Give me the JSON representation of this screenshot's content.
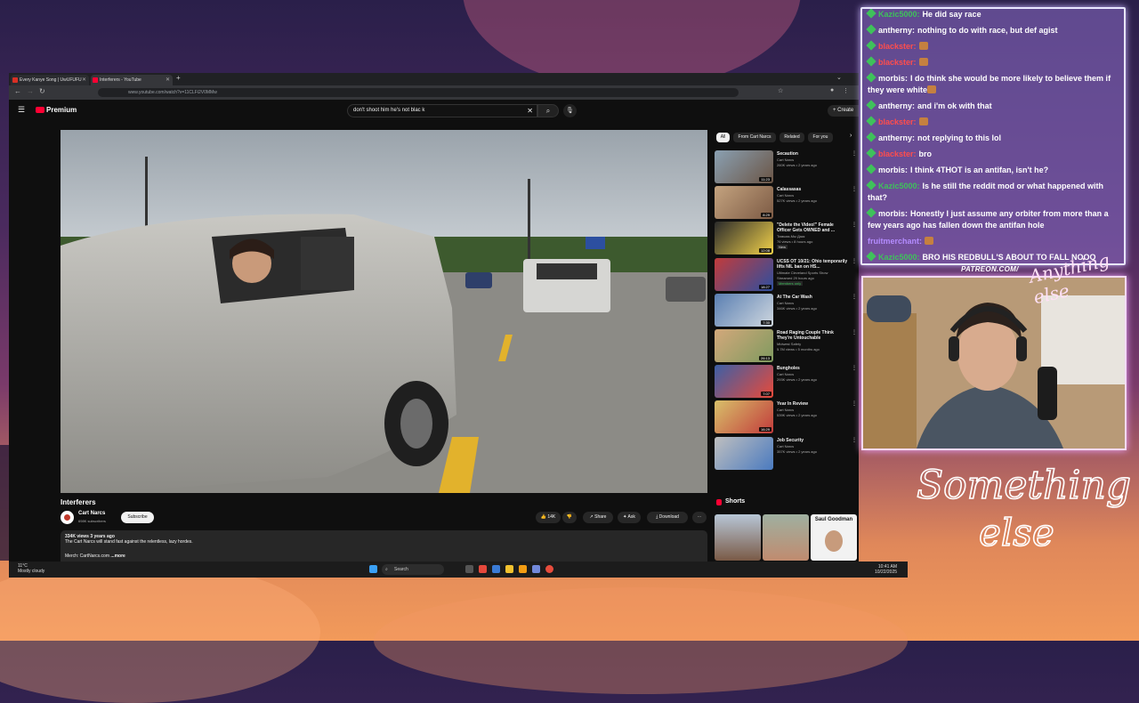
{
  "browser": {
    "tabs": [
      {
        "label": "Every Kanye Song | UwUFUFU"
      },
      {
        "label": "Interferers - YouTube"
      }
    ],
    "url": "www.youtube.com/watch?v=11CLFi2V0MMw"
  },
  "youtube": {
    "logo_label": "Premium",
    "search_query": "don't shoot him he's not blac k",
    "create_label": "Create",
    "video": {
      "title": "Interferers",
      "channel": "Cart Narcs",
      "subscribers": "698K subscribers",
      "subscribe_label": "Subscribe",
      "likes": "14K",
      "share_label": "Share",
      "ask_label": "Ask",
      "download_label": "Download",
      "description_meta": "334K views  3 years ago",
      "description_text": "The Cart Narcs will stand fast against the relentless, lazy hordes.",
      "description_link": "Merch: CartNarcs.com",
      "description_more": "...more"
    },
    "chips": [
      "All",
      "From Cart Narcs",
      "Related",
      "For you"
    ],
    "recommendations": [
      {
        "title": "Secaution",
        "channel": "Cart Narcs",
        "meta": "260K views • 2 years ago",
        "duration": "11:23"
      },
      {
        "title": "Calassasas",
        "channel": "Cart Narcs",
        "meta": "527K views • 2 years ago",
        "duration": "8:29"
      },
      {
        "title": "\"Delete the Video!\" Female Officer Gets OWNED and ...",
        "channel": "Тимьма-Мы Дакк",
        "meta": "76 views • 8 hours ago",
        "duration": "12:08",
        "badge": "New"
      },
      {
        "title": "UCSS OT 10/21: Ohio temporarily lifts NIL ban on HS...",
        "channel": "Ultimate Cleveland Sports Show",
        "meta": "Streamed 29 hours ago",
        "duration": "18:27",
        "badge": "Members only"
      },
      {
        "title": "At The Car Wash",
        "channel": "Cart Narcs",
        "meta": "346K views • 2 years ago",
        "duration": "7:30"
      },
      {
        "title": "Road Raging Couple Think They're Untouchable",
        "channel": "Midwest Safety",
        "meta": "5.7M views • 5 months ago",
        "duration": "26:13"
      },
      {
        "title": "Bungholes",
        "channel": "Cart Narcs",
        "meta": "293K views • 2 years ago",
        "duration": "7:07"
      },
      {
        "title": "Year In Review",
        "channel": "Cart Narcs",
        "meta": "539K views • 2 years ago",
        "duration": "16:29"
      },
      {
        "title": "Job Security",
        "channel": "Cart Narcs",
        "meta": "357K views • 2 years ago",
        "duration": ""
      }
    ],
    "shorts_label": "Shorts",
    "shorts": [
      {
        "caption": ""
      },
      {
        "caption": ""
      },
      {
        "caption": "Saul Goodman"
      }
    ]
  },
  "taskbar": {
    "weather_temp": "11°C",
    "weather_desc": "Mostly cloudy",
    "search_label": "Search",
    "time": "10:41 AM",
    "date": "10/22/2025"
  },
  "chat": {
    "messages": [
      {
        "user": "Kazic5000:",
        "text": "He did say race",
        "user_color": "#3fc15b",
        "badge": true
      },
      {
        "user": "antherny:",
        "text": "nothing to do with race, but def agist",
        "user_color": "#ffffff",
        "badge": true
      },
      {
        "user": "blackster:",
        "text": "",
        "user_color": "#ff4d4d",
        "badge": true,
        "emote": true
      },
      {
        "user": "blackster:",
        "text": "",
        "user_color": "#ff4d4d",
        "badge": true,
        "emote": true
      },
      {
        "user": "morbis:",
        "text": "I do think she would be more likely to believe them if they were white",
        "user_color": "#ffffff",
        "badge": true,
        "emote": true
      },
      {
        "user": "antherny:",
        "text": "and i'm ok with that",
        "user_color": "#ffffff",
        "badge": true
      },
      {
        "user": "blackster:",
        "text": "",
        "user_color": "#ff4d4d",
        "badge": true,
        "emote": true
      },
      {
        "user": "antherny:",
        "text": "not replying to this lol",
        "user_color": "#ffffff",
        "badge": true
      },
      {
        "user": "blackster:",
        "text": "bro",
        "user_color": "#ff4d4d",
        "badge": true
      },
      {
        "user": "morbis:",
        "text": "I think 4THOT is an antifan, isn't he?",
        "user_color": "#ffffff",
        "badge": true
      },
      {
        "user": "Kazic5000:",
        "text": "Is he still the reddit mod or what happened with that?",
        "user_color": "#3fc15b",
        "badge": true
      },
      {
        "user": "morbis:",
        "text": "Honestly I just assume any orbiter from more than a few years ago has fallen down the antifan hole",
        "user_color": "#ffffff",
        "badge": true
      },
      {
        "user": "fruitmerchant:",
        "text": "",
        "user_color": "#b48cff",
        "badge": false,
        "emote": true
      },
      {
        "user": "Kazic5000:",
        "text": "BRO HIS REDBULL'S ABOUT TO FALL NOOO",
        "user_color": "#3fc15b",
        "badge": true
      }
    ]
  },
  "overlay": {
    "patreon": "PATREON.COM/",
    "logo_script": "Anything else",
    "brand_script": "Something else"
  },
  "colors": {
    "youtube_red": "#ff0033",
    "chat_border": "#e8e6ff",
    "badge_green": "#3fc15b"
  }
}
